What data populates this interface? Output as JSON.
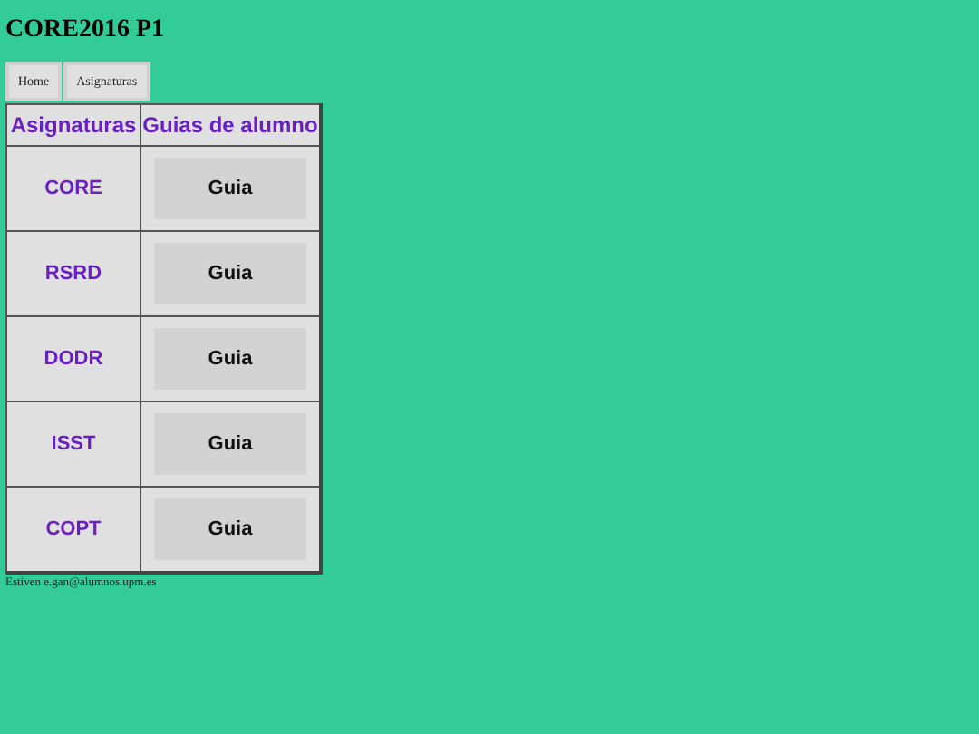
{
  "title": "CORE2016 P1",
  "nav": [
    "Home",
    "Asignaturas"
  ],
  "table": {
    "columns": [
      "Asignaturas",
      "Guias de alumno"
    ],
    "rows": [
      {
        "subject": "CORE",
        "button": "Guia"
      },
      {
        "subject": "RSRD",
        "button": "Guia"
      },
      {
        "subject": "DODR",
        "button": "Guia"
      },
      {
        "subject": "ISST",
        "button": "Guia"
      },
      {
        "subject": "COPT",
        "button": "Guia"
      }
    ]
  },
  "footer": "Estiven e.gan@alumnos.upm.es"
}
